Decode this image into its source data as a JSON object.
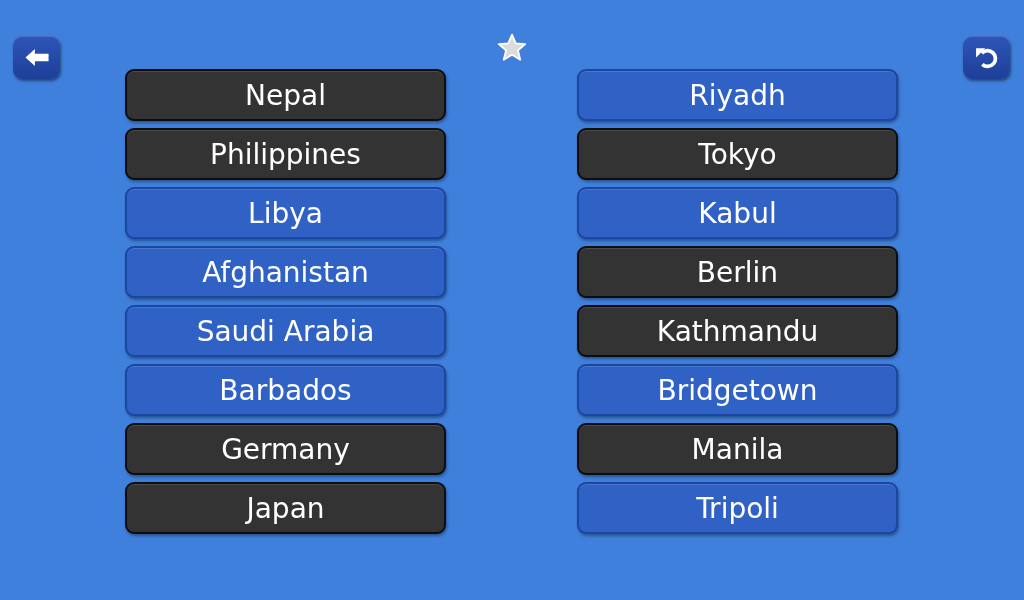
{
  "countries": [
    {
      "label": "Nepal",
      "matched": true
    },
    {
      "label": "Philippines",
      "matched": true
    },
    {
      "label": "Libya",
      "matched": false
    },
    {
      "label": "Afghanistan",
      "matched": false
    },
    {
      "label": "Saudi Arabia",
      "matched": false
    },
    {
      "label": "Barbados",
      "matched": false
    },
    {
      "label": "Germany",
      "matched": true
    },
    {
      "label": "Japan",
      "matched": true
    }
  ],
  "capitals": [
    {
      "label": "Riyadh",
      "matched": false
    },
    {
      "label": "Tokyo",
      "matched": true
    },
    {
      "label": "Kabul",
      "matched": false
    },
    {
      "label": "Berlin",
      "matched": true
    },
    {
      "label": "Kathmandu",
      "matched": true
    },
    {
      "label": "Bridgetown",
      "matched": false
    },
    {
      "label": "Manila",
      "matched": true
    },
    {
      "label": "Tripoli",
      "matched": false
    }
  ]
}
